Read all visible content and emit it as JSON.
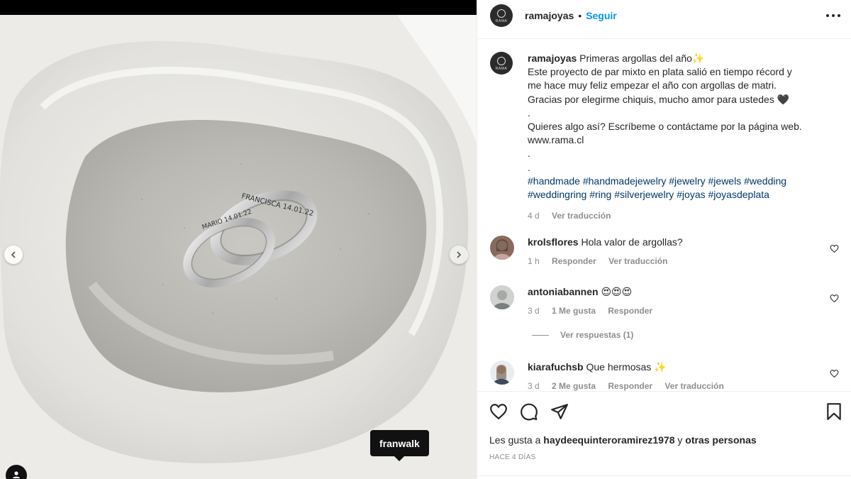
{
  "post": {
    "author": "ramajoyas",
    "author_logo_text": "RAMA",
    "follow_label": "Seguir",
    "separator": "•",
    "photo": {
      "ring_engraving_large": "FRANCISCA 14.01.22",
      "ring_engraving_small": "MARIO 14.01.22",
      "tag_tooltip": "franwalk"
    }
  },
  "caption": {
    "username": "ramajoyas",
    "lines": [
      "Primeras argollas del año✨",
      "Este proyecto de par mixto en plata salió en tiempo récord y",
      "me hace muy feliz empezar el año con argollas de matri.",
      "Gracias por elegirme chiquis, mucho amor para ustedes 🖤",
      ".",
      "Quieres algo así? Escríbeme o contáctame por la página web.",
      "www.rama.cl",
      ".",
      "."
    ],
    "hashtags_line1": [
      "#handmade",
      "#handmadejewelry",
      "#jewelry",
      "#jewels",
      "#wedding"
    ],
    "hashtags_line2": [
      "#weddingring",
      "#ring",
      "#silverjewelry",
      "#joyas",
      "#joyasdeplata"
    ],
    "time": "4 d",
    "translate": "Ver traducción"
  },
  "comments": [
    {
      "username": "krolsflores",
      "text": "Hola valor de argollas?",
      "time": "1 h",
      "likes": "",
      "reply": "Responder",
      "translate": "Ver traducción"
    },
    {
      "username": "antoniabannen",
      "text": "😍😍😍",
      "time": "3 d",
      "likes": "1 Me gusta",
      "reply": "Responder",
      "translate": ""
    },
    {
      "username": "kiarafuchsb",
      "text": "Que hermosas ✨",
      "time": "3 d",
      "likes": "2 Me gusta",
      "reply": "Responder",
      "translate": "Ver traducción"
    }
  ],
  "view_replies": "Ver respuestas (1)",
  "likes": {
    "prefix": "Les gusta a",
    "user": "haydeequinteroramirez1978",
    "suffix": "y",
    "others": "otras personas"
  },
  "time_ago": "HACE 4 DÍAS",
  "icons": [
    "heart-icon",
    "comment-icon",
    "share-icon",
    "bookmark-icon",
    "more-icon",
    "chevron-left-icon",
    "chevron-right-icon",
    "user-tag-icon"
  ],
  "colors": {
    "link_blue": "#0095f6",
    "hashtag": "#00376b",
    "muted": "#8e8e8e",
    "text": "#262626"
  }
}
